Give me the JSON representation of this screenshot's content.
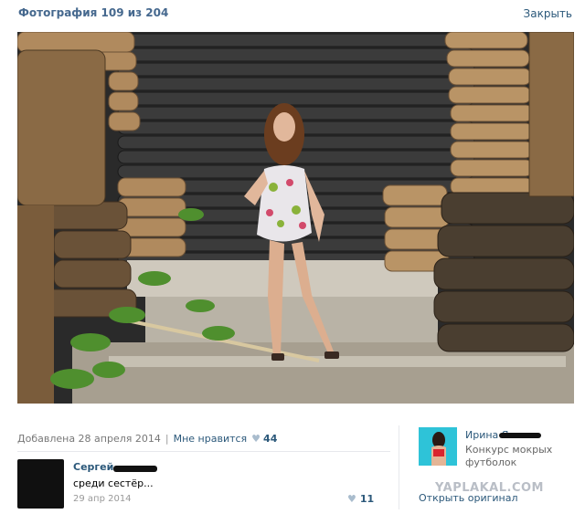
{
  "header": {
    "title": "Фотография 109 из 204",
    "close_label": "Закрыть"
  },
  "photo_info": {
    "added_label": "Добавлена 28 апреля 2014",
    "separator": "|",
    "dislike_label": "Мне нравится",
    "like_count": "44"
  },
  "comment": {
    "author": "Сергей",
    "text": "среди сестёр...",
    "date": "29 апр 2014",
    "likes": "11"
  },
  "album_preview": {
    "user_name": "Ирина Я",
    "description": "Конкурс мокрых футболок",
    "open_original_label": "Открыть оригинал"
  },
  "watermark": "YAPLAKAL.COM",
  "icons": {
    "heart": "heart-icon"
  },
  "colors": {
    "link": "#2b587a",
    "title": "#45688e",
    "muted": "#777777"
  }
}
